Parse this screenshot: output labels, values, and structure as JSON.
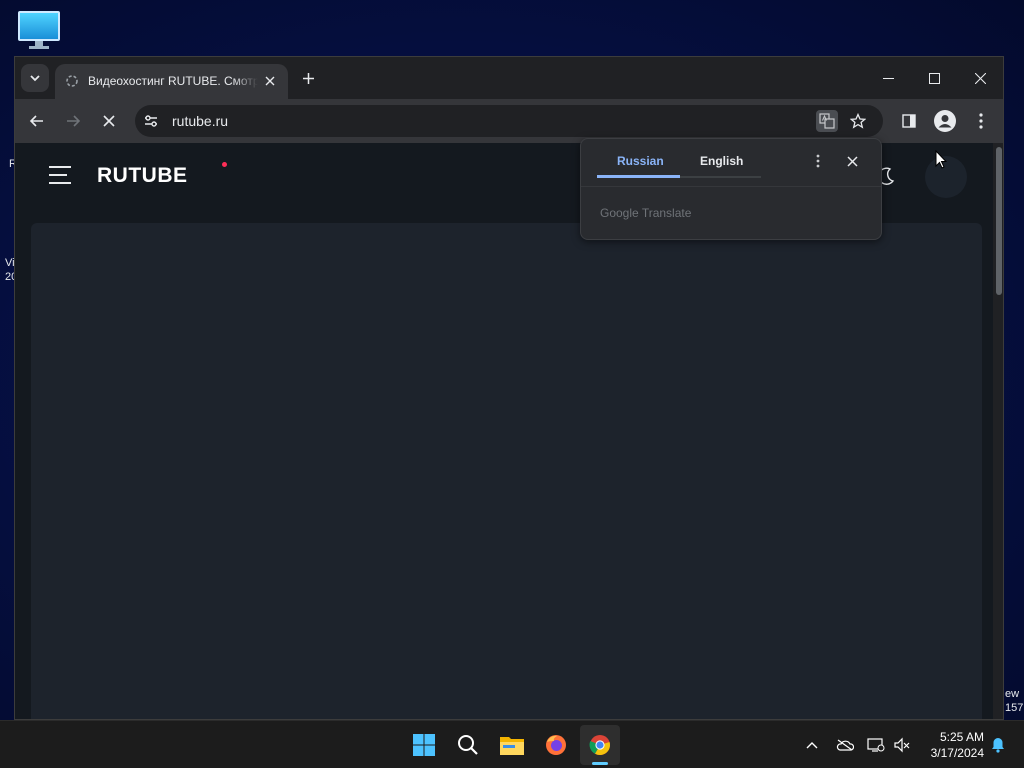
{
  "desktop": {
    "left_edge_texts": [
      "R",
      "Vi",
      "20"
    ],
    "right_edge_texts": [
      "ew",
      "157"
    ]
  },
  "browser": {
    "tab": {
      "title": "Видеохостинг RUTUBE. Смотрите онлайн"
    },
    "address": {
      "url": "rutube.ru"
    }
  },
  "page": {
    "logo": "RUTUBE"
  },
  "translate_popup": {
    "source_lang": "Russian",
    "target_lang": "English",
    "footer": "Google Translate"
  },
  "taskbar": {
    "time": "5:25 AM",
    "date": "3/17/2024"
  },
  "colors": {
    "accent_blue": "#8ab4f8",
    "logo_dot": "#ff2e57",
    "taskbar_indicator": "#60cdff"
  }
}
